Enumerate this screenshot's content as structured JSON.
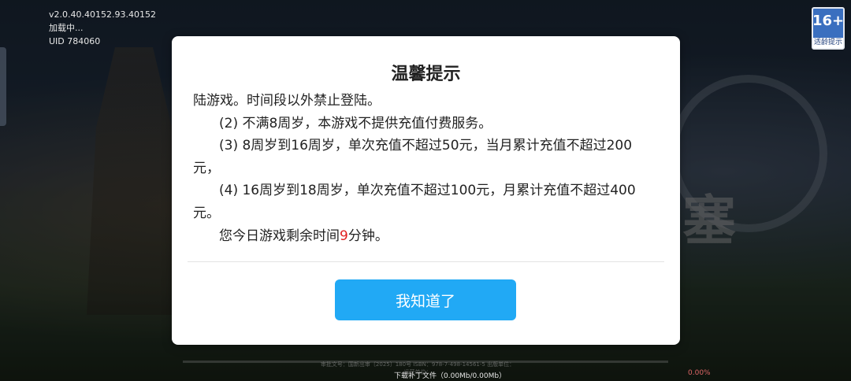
{
  "hud": {
    "version": "v2.0.40.40152.93.40152",
    "status": "加载中...",
    "uid": "UID 784060"
  },
  "age_rating": {
    "number": "16+",
    "label": "适龄提示"
  },
  "dialog": {
    "title": "温馨提示",
    "lines": [
      "陆游戏。时间段以外禁止登陆。",
      "(2) 不满8周岁，本游戏不提供充值付费服务。",
      "(3) 8周岁到16周岁，单次充值不超过50元，当月累计充值不超过200元，",
      "(4) 16周岁到18周岁，单次充值不超过100元，月累计充值不超过400元。"
    ],
    "remaining_prefix": "您今日游戏剩余时间",
    "remaining_value": "9",
    "remaining_suffix": "分钟。",
    "confirm_label": "我知道了"
  },
  "footer": {
    "line1": "审批文号：国新出审〔2025〕180号 ISBN：978-7-498-14561-5 出版单位：",
    "line2": "运营单位：",
    "download_text": "下载补丁文件（0.00Mb/0.00Mb）",
    "progress_percent": "0.00%",
    "progress": 0
  },
  "colors": {
    "button": "#21a9f5",
    "highlight": "#e02020"
  }
}
